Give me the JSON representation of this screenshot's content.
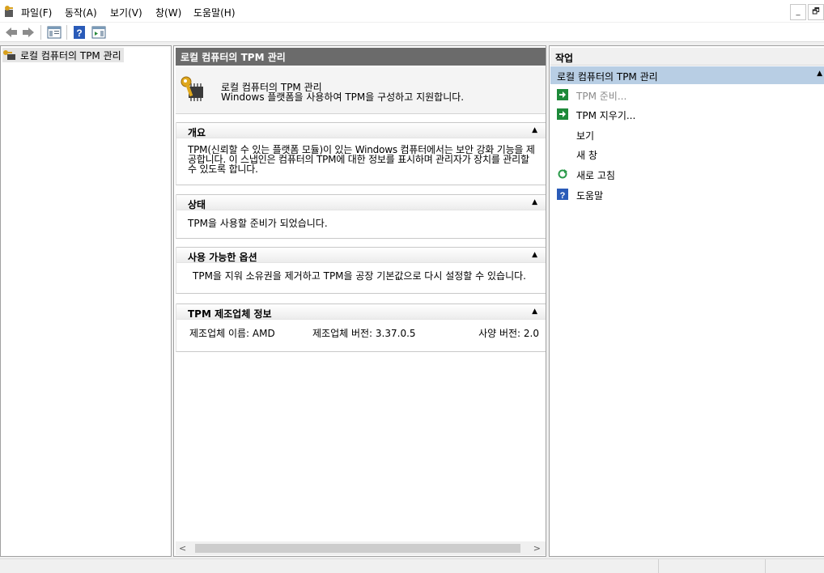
{
  "menubar": {
    "items": [
      "파일(F)",
      "동작(A)",
      "보기(V)",
      "창(W)",
      "도움말(H)"
    ],
    "window_controls": [
      "_",
      "🗗"
    ]
  },
  "toolbar": {
    "buttons": [
      "back-icon",
      "forward-icon",
      "show-hide-tree-icon",
      "help-icon",
      "show-hide-action-pane-icon"
    ]
  },
  "tree": {
    "root_label": "로컬 컴퓨터의 TPM 관리"
  },
  "center": {
    "header": "로컬 컴퓨터의 TPM 관리",
    "intro_title": "로컬 컴퓨터의 TPM 관리",
    "intro_desc": "Windows 플랫폼을 사용하여 TPM을 구성하고 지원합니다.",
    "sections": {
      "overview": {
        "title": "개요",
        "body": "TPM(신뢰할 수 있는 플랫폼 모듈)이 있는 Windows 컴퓨터에서는 보안 강화 기능을 제공합니다. 이 스냅인은 컴퓨터의 TPM에 대한 정보를 표시하며 관리자가 장치를 관리할 수 있도록 합니다."
      },
      "status": {
        "title": "상태",
        "body": "TPM을 사용할 준비가 되었습니다."
      },
      "options": {
        "title": "사용 가능한 옵션",
        "body": "TPM을 지워 소유권을 제거하고 TPM을 공장 기본값으로 다시 설정할 수 있습니다."
      },
      "manufacturer": {
        "title": "TPM 제조업체 정보",
        "name": "제조업체 이름: AMD",
        "version": "제조업체 버전: 3.37.0.5",
        "spec": "사양 버전: 2.0"
      }
    },
    "collapse_glyph": "▲"
  },
  "actions": {
    "header": "작업",
    "group": "로컬 컴퓨터의 TPM 관리",
    "items": [
      {
        "label": "TPM 준비...",
        "icon": "green-arrow-icon",
        "enabled": false
      },
      {
        "label": "TPM 지우기...",
        "icon": "green-arrow-icon",
        "enabled": true
      },
      {
        "label": "보기",
        "icon": "",
        "enabled": true
      },
      {
        "label": "새 창",
        "icon": "",
        "enabled": true
      },
      {
        "label": "새로 고침",
        "icon": "refresh-icon",
        "enabled": true
      },
      {
        "label": "도움말",
        "icon": "help-icon",
        "enabled": true
      }
    ]
  },
  "colors": {
    "center_header": "#6b6b6b",
    "action_group_highlight": "#b8cee4",
    "action_green": "#1e8a3a",
    "help_blue": "#2a5bb8"
  }
}
